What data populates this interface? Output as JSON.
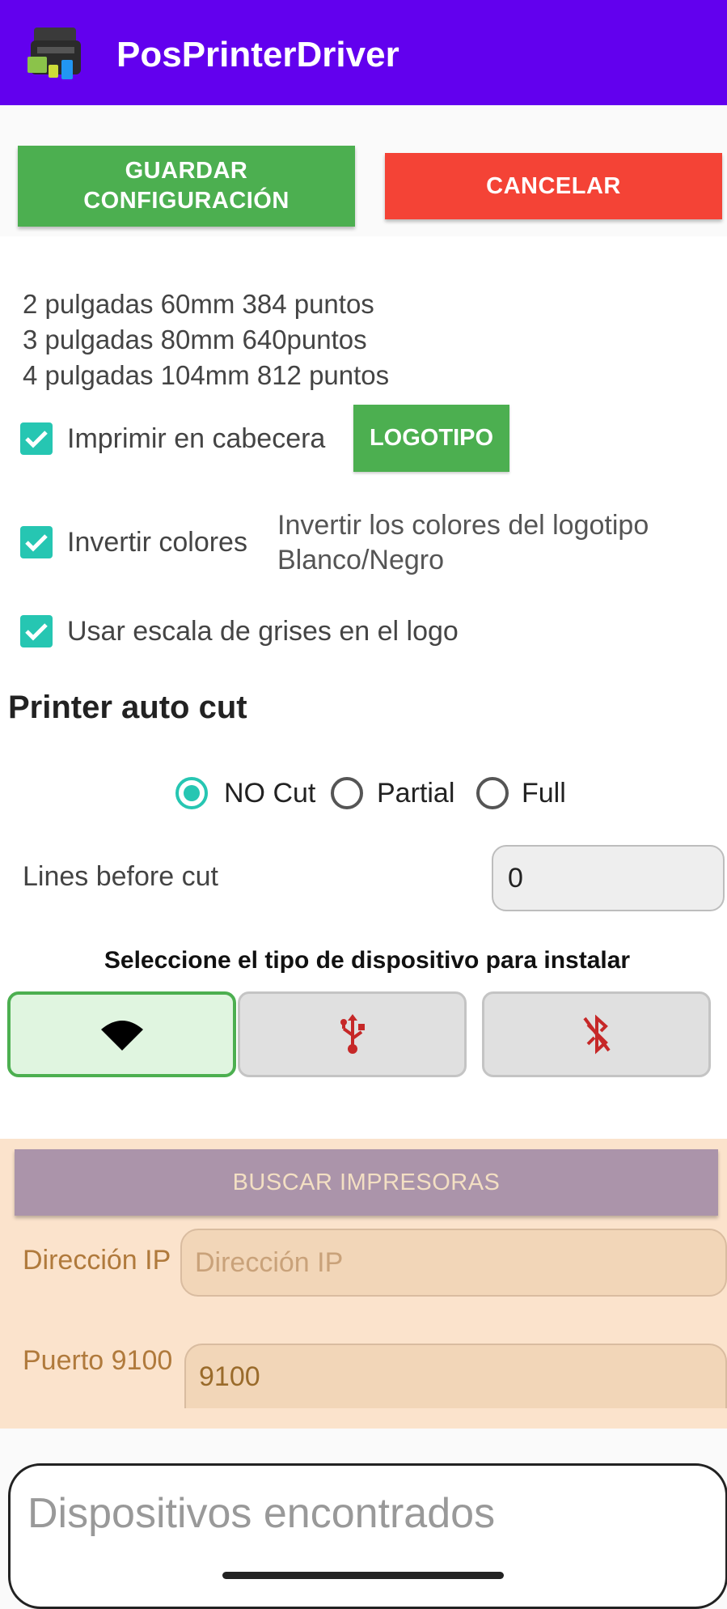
{
  "app": {
    "title": "PosPrinterDriver",
    "bar_color": "#6200ee"
  },
  "actions": {
    "save_label": "GUARDAR\nCONFIGURACIÓN",
    "cancel_label": "CANCELAR"
  },
  "paper_sizes": [
    "2 pulgadas 60mm 384 puntos",
    "3 pulgadas 80mm 640puntos",
    "4 pulgadas 104mm 812 puntos"
  ],
  "options": {
    "print_header": {
      "label": "Imprimir en cabecera",
      "checked": true
    },
    "logo_button": "LOGOTIPO",
    "invert_colors": {
      "label": "Invertir colores",
      "checked": true,
      "description": "Invertir los colores del logotipo Blanco/Negro"
    },
    "grayscale": {
      "label": "Usar escala de grises en el logo",
      "checked": true
    }
  },
  "auto_cut": {
    "title": "Printer auto cut",
    "options": [
      "NO Cut",
      "Partial",
      "Full"
    ],
    "selected": "NO Cut",
    "lines_label": "Lines before cut",
    "lines_value": "0"
  },
  "device": {
    "title": "Seleccione el tipo de dispositivo para instalar",
    "types": [
      {
        "icon": "wifi-icon",
        "selected": true
      },
      {
        "icon": "usb-icon",
        "selected": false
      },
      {
        "icon": "bluetooth-disabled-icon",
        "selected": false
      }
    ]
  },
  "network": {
    "search_label": "BUSCAR IMPRESORAS",
    "ip_label": "Dirección IP",
    "ip_placeholder": "Dirección IP",
    "port_label": "Puerto 9100",
    "port_value": "9100"
  },
  "found": {
    "label": "Dispositivos encontrados"
  },
  "colors": {
    "green": "#4caf50",
    "red": "#f44336",
    "teal": "#26c6b2",
    "panel": "#fbe3cc"
  }
}
